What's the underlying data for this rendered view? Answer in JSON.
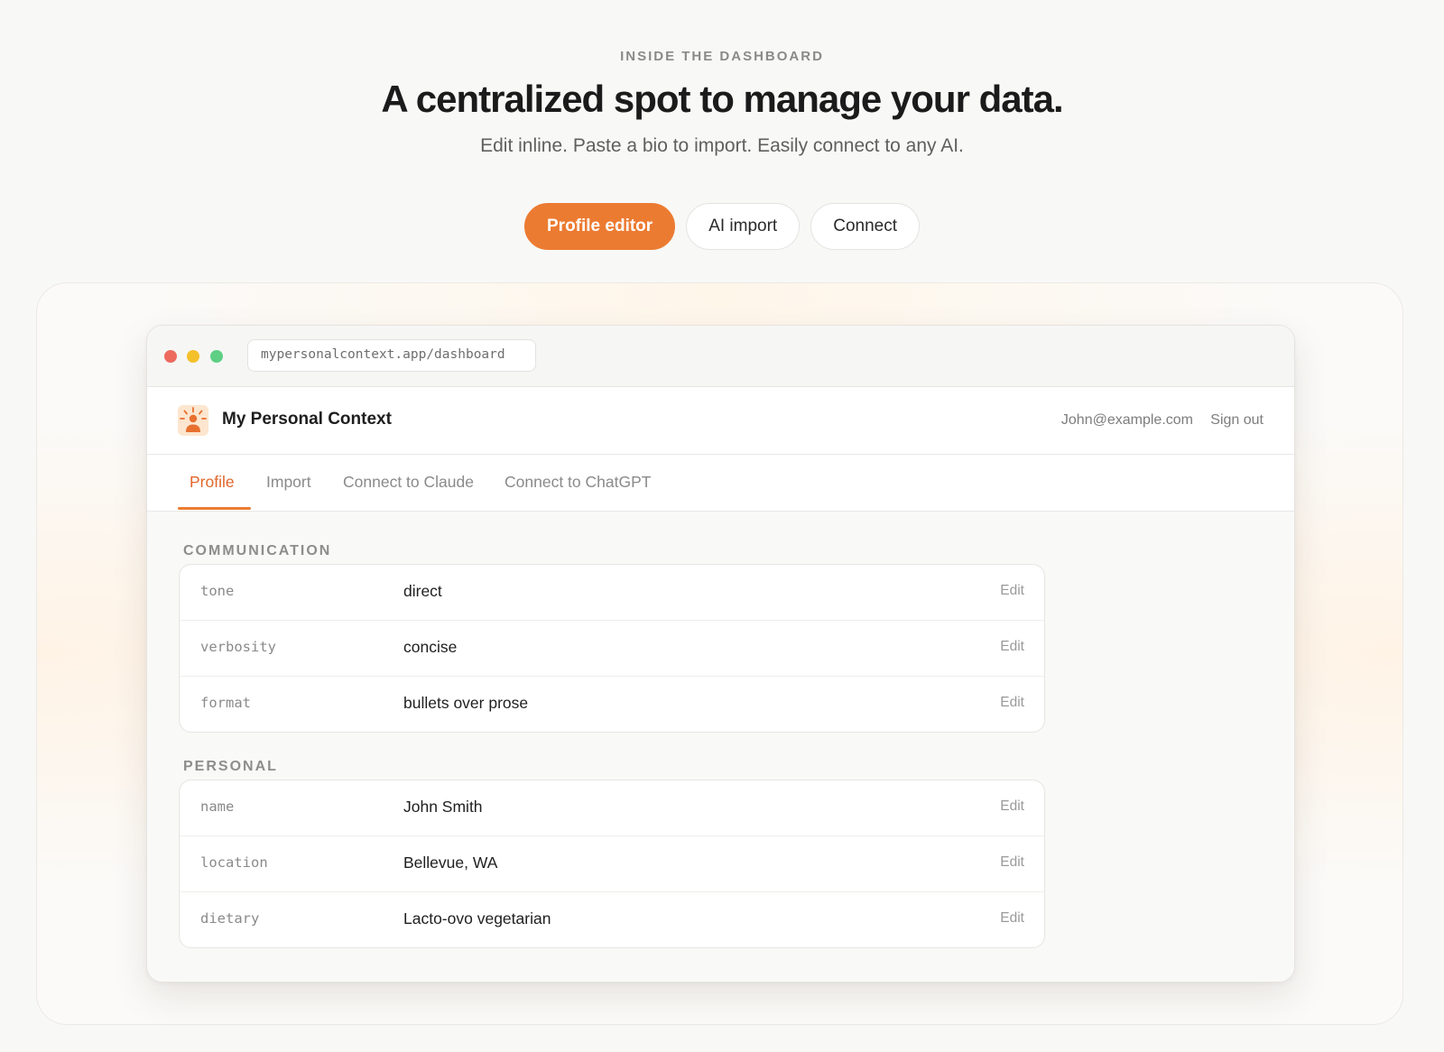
{
  "hero": {
    "eyebrow": "INSIDE THE DASHBOARD",
    "headline": "A centralized spot to manage your data.",
    "subhead": "Edit inline. Paste a bio to import. Easily connect to any AI.",
    "tabs": [
      {
        "label": "Profile editor",
        "active": true
      },
      {
        "label": "AI import",
        "active": false
      },
      {
        "label": "Connect",
        "active": false
      }
    ]
  },
  "browser": {
    "url": "mypersonalcontext.app/dashboard"
  },
  "app": {
    "title": "My Personal Context",
    "user_email": "John@example.com",
    "sign_out": "Sign out",
    "nav": [
      {
        "label": "Profile",
        "active": true
      },
      {
        "label": "Import",
        "active": false
      },
      {
        "label": "Connect to Claude",
        "active": false
      },
      {
        "label": "Connect to ChatGPT",
        "active": false
      }
    ]
  },
  "sections": [
    {
      "label": "COMMUNICATION",
      "rows": [
        {
          "key": "tone",
          "value": "direct",
          "action": "Edit"
        },
        {
          "key": "verbosity",
          "value": "concise",
          "action": "Edit"
        },
        {
          "key": "format",
          "value": "bullets over prose",
          "action": "Edit"
        }
      ]
    },
    {
      "label": "PERSONAL",
      "rows": [
        {
          "key": "name",
          "value": "John Smith",
          "action": "Edit"
        },
        {
          "key": "location",
          "value": "Bellevue, WA",
          "action": "Edit"
        },
        {
          "key": "dietary",
          "value": "Lacto-ovo vegetarian",
          "action": "Edit"
        }
      ]
    }
  ],
  "colors": {
    "accent": "#ec7b32",
    "active_tab_text": "#e0662b",
    "window_red": "#ed6a5e",
    "window_yellow": "#f4c02c",
    "window_green": "#5fcf85"
  }
}
